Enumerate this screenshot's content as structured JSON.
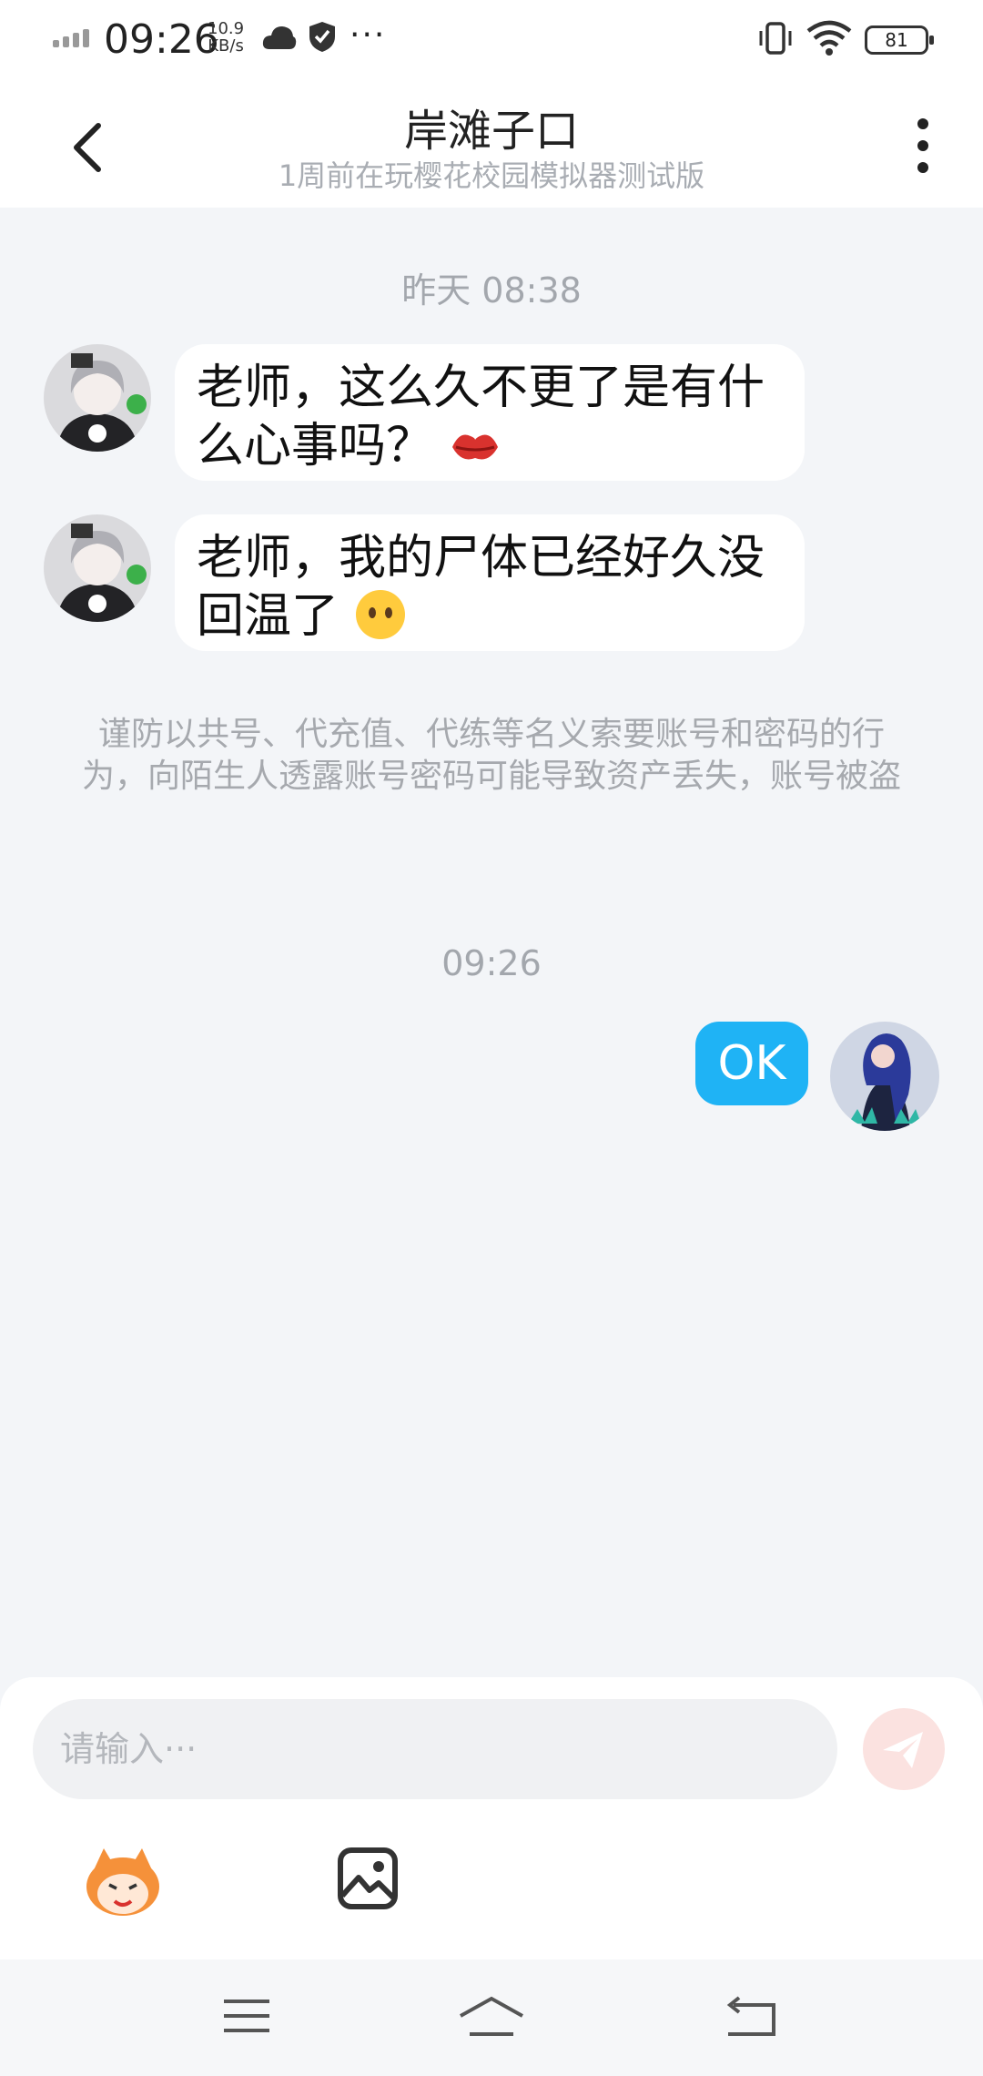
{
  "status_bar": {
    "time": "09:26",
    "speed_value": "10.9",
    "speed_unit": "KB/s",
    "battery": "81",
    "more": "···"
  },
  "header": {
    "title": "岸滩子口",
    "subtitle": "1周前在玩樱花校园模拟器测试版"
  },
  "messages": {
    "timestamp_1": "昨天 08:38",
    "msg_1": "老师，这么久不更了是有什么心事吗？",
    "msg_2": "老师，我的尸体已经好久没回温了",
    "notice": "谨防以共号、代充值、代练等名义索要账号和密码的行为，向陌生人透露账号密码可能导致资产丢失，账号被盗",
    "timestamp_2": "09:26",
    "my_msg": "OK"
  },
  "composer": {
    "placeholder": "请输入···"
  },
  "colors": {
    "accent": "#1FB3F5",
    "background": "#F3F5F8",
    "send_button": "#FBE2E0"
  }
}
